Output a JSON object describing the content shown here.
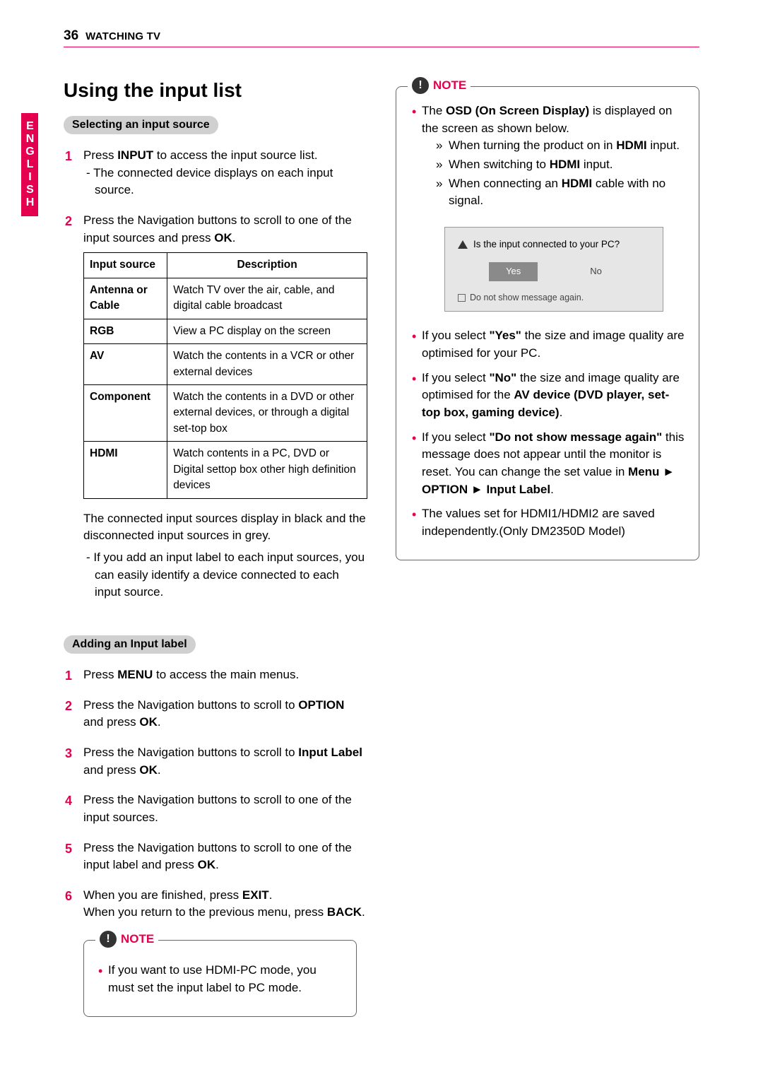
{
  "header": {
    "page_number": "36",
    "section": "WATCHING TV"
  },
  "language_tab": "ENGLISH",
  "left": {
    "title": "Using the input list",
    "pill1": "Selecting an input source",
    "step1a": "Press ",
    "step1b": "INPUT",
    "step1c": " to access the input source list.",
    "step1_sub": "The connected device displays on each input source.",
    "step2a": "Press the Navigation buttons to scroll to one of the input sources and press ",
    "step2b": "OK",
    "step2c": ".",
    "table": {
      "h1": "Input source",
      "h2": "Description",
      "rows": [
        {
          "src": "Antenna or Cable",
          "desc": "Watch TV over the air, cable, and digital cable broadcast"
        },
        {
          "src": "RGB",
          "desc": "View a PC display on the screen"
        },
        {
          "src": "AV",
          "desc": "Watch the contents in a VCR or other external devices"
        },
        {
          "src": "Component",
          "desc": "Watch the contents in a DVD or other external devices, or through a digital set-top box"
        },
        {
          "src": "HDMI",
          "desc": "Watch contents in a PC, DVD or Digital settop box other high definition devices"
        }
      ]
    },
    "after_table1": "The connected input sources display in black and the disconnected input sources in grey.",
    "after_table2": "If you add an input label to each input sources, you can easily identify a device connected to each input source.",
    "pill2": "Adding an Input label",
    "steps2": {
      "s1a": "Press ",
      "s1b": "MENU",
      "s1c": " to access the main menus.",
      "s2a": "Press the Navigation buttons to scroll to ",
      "s2b": "OPTION",
      "s2c": " and press ",
      "s2d": "OK",
      "s2e": ".",
      "s3a": "Press the Navigation buttons to scroll to ",
      "s3b": "Input Label",
      "s3c": " and press ",
      "s3d": "OK",
      "s3e": ".",
      "s4": "Press the Navigation buttons to scroll to one of the input sources.",
      "s5a": "Press the Navigation buttons to scroll to one of the input label and press ",
      "s5b": "OK",
      "s5c": ".",
      "s6a": "When you are finished, press ",
      "s6b": "EXIT",
      "s6c": ".",
      "s6d": "When you return to the previous menu, press ",
      "s6e": "BACK",
      "s6f": "."
    },
    "note_label": "NOTE",
    "note_small": "If you want to use HDMI-PC mode, you must set the input label to PC mode."
  },
  "right": {
    "note_label": "NOTE",
    "intro_a": "The ",
    "intro_b": "OSD (On Screen Display)",
    "intro_c": " is displayed on the screen as shown below.",
    "chev1a": "When turning the product on in ",
    "chev1b": "HDMI",
    "chev1c": " input.",
    "chev2a": "When switching to ",
    "chev2b": "HDMI",
    "chev2c": " input.",
    "chev3a": "When connecting an ",
    "chev3b": "HDMI",
    "chev3c": " cable with no signal.",
    "osd": {
      "question": "Is the input connected to your PC?",
      "yes": "Yes",
      "no": "No",
      "check": "Do not show message again."
    },
    "b1a": "If you select ",
    "b1b": "\"Yes\"",
    "b1c": " the size and image quality are optimised for your PC.",
    "b2a": "If you select ",
    "b2b": "\"No\"",
    "b2c": " the size and image quality are optimised for the ",
    "b2d": "AV device (DVD player, set-top box, gaming device)",
    "b2e": ".",
    "b3a": "If you select ",
    "b3b": "\"Do not show message again\"",
    "b3c": " this message does not appear until the monitor is reset. You can change the set value in ",
    "b3d": "Menu ► OPTION ► Input Label",
    "b3e": ".",
    "b4": "The values set for HDMI1/HDMI2 are saved independently.(Only DM2350D Model)"
  }
}
